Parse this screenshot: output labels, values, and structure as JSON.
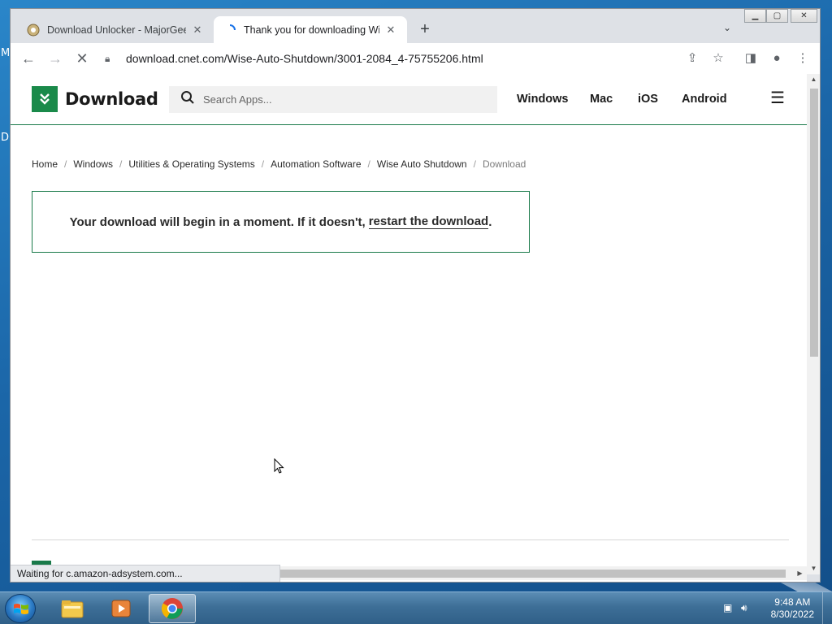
{
  "desktop": {
    "letters": [
      "M",
      "D"
    ]
  },
  "browser": {
    "tabs": [
      {
        "title": "Download Unlocker - MajorGeeks",
        "close": "✕"
      },
      {
        "title": "Thank you for downloading Wise",
        "close": "✕"
      }
    ],
    "new_tab": "+",
    "url": "download.cnet.com/Wise-Auto-Shutdown/3001-2084_4-75755206.html",
    "status_text": "Waiting for c.amazon-adsystem.com..."
  },
  "site": {
    "logo_text": "Download",
    "search_placeholder": "Search Apps...",
    "nav": [
      "Windows",
      "Mac",
      "iOS",
      "Android"
    ],
    "breadcrumb": [
      "Home",
      "Windows",
      "Utilities & Operating Systems",
      "Automation Software",
      "Wise Auto Shutdown",
      "Download"
    ],
    "breadcrumb_sep": "/",
    "notice_text": "Your download will begin in a moment. If it doesn't,",
    "notice_link": "restart the download",
    "notice_end": "."
  },
  "taskbar": {
    "time": "9:48 AM",
    "date": "8/30/2022"
  },
  "colors": {
    "brand_green": "#1a8a4a",
    "taskbar": "#3e6f97"
  }
}
